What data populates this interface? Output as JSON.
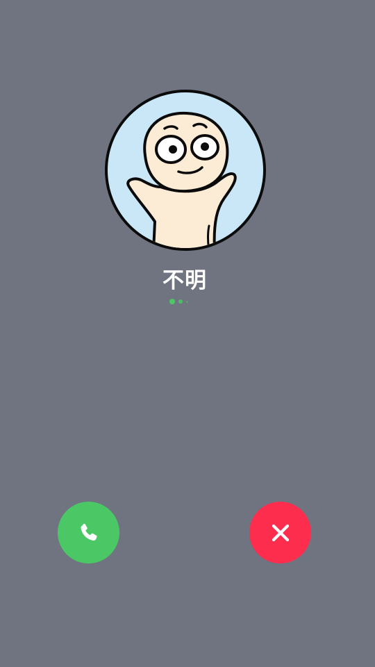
{
  "call": {
    "caller_name": "不明",
    "status_indicator": "connecting-dots"
  },
  "avatar": {
    "description_icon": "cartoon-character-avatar"
  },
  "actions": {
    "accept": {
      "icon": "phone-icon",
      "color": "#4cc765"
    },
    "decline": {
      "icon": "close-icon",
      "color": "#fd2d4d"
    }
  },
  "colors": {
    "background": "#6f7480",
    "avatar_bg": "#c9e7f7",
    "text": "#ffffff",
    "dots": "#4cc765"
  }
}
